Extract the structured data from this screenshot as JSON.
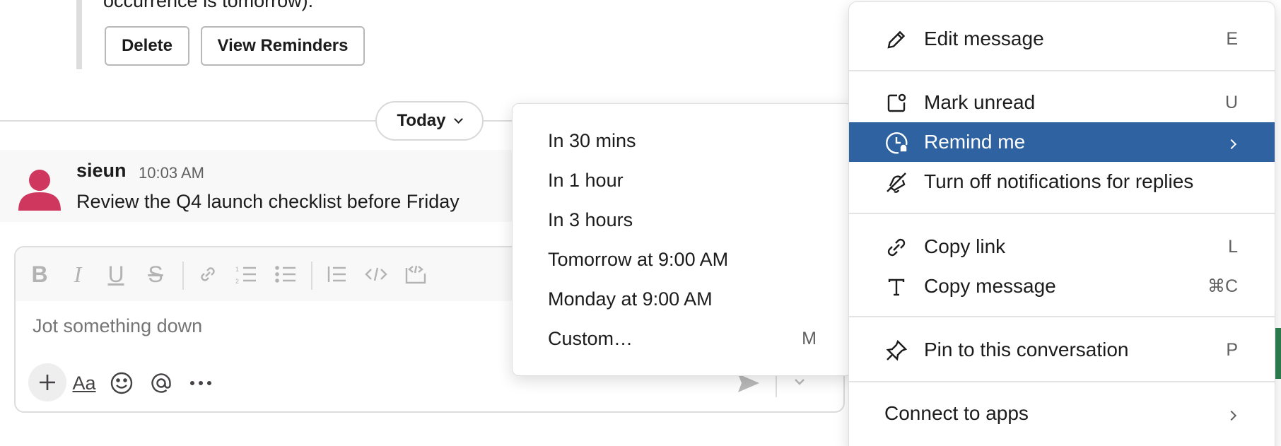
{
  "reminder": {
    "text": "occurrence is tomorrow).",
    "delete_label": "Delete",
    "view_label": "View Reminders"
  },
  "divider": {
    "label": "Today"
  },
  "message": {
    "author": "sieun",
    "time": "10:03 AM",
    "text": "Review the Q4 launch checklist before Friday",
    "avatar_color": "#d0375e"
  },
  "composer": {
    "placeholder": "Jot something down",
    "toolbar_icons": [
      "bold-icon",
      "italic-icon",
      "underline-icon",
      "strikethrough-icon",
      "link-icon",
      "ordered-list-icon",
      "bulleted-list-icon",
      "blockquote-icon",
      "code-icon",
      "code-block-icon"
    ],
    "bottom_icons": [
      "plus-icon",
      "format-text-icon",
      "emoji-icon",
      "mention-icon",
      "more-icon"
    ],
    "format_label": "Aa"
  },
  "remind_submenu": {
    "items": [
      {
        "label": "In 30 mins",
        "shortcut": ""
      },
      {
        "label": "In 1 hour",
        "shortcut": ""
      },
      {
        "label": "In 3 hours",
        "shortcut": ""
      },
      {
        "label": "Tomorrow at 9:00 AM",
        "shortcut": ""
      },
      {
        "label": "Monday at 9:00 AM",
        "shortcut": ""
      },
      {
        "label": "Custom…",
        "shortcut": "M"
      }
    ]
  },
  "context_menu": {
    "accent": "#2e62a1",
    "items": [
      {
        "label": "Edit message",
        "shortcut": "E",
        "icon": "pencil-icon"
      },
      {
        "label": "Mark unread",
        "shortcut": "U",
        "icon": "mark-unread-icon"
      },
      {
        "label": "Remind me",
        "shortcut": "",
        "icon": "clock-icon",
        "active": true
      },
      {
        "label": "Turn off notifications for replies",
        "shortcut": "",
        "icon": "bell-off-icon"
      },
      {
        "label": "Copy link",
        "shortcut": "L",
        "icon": "link-icon"
      },
      {
        "label": "Copy message",
        "shortcut": "⌘C",
        "icon": "text-icon"
      },
      {
        "label": "Pin to this conversation",
        "shortcut": "P",
        "icon": "pin-icon"
      },
      {
        "label": "Connect to apps",
        "shortcut": "",
        "icon": "chevron-right-icon"
      }
    ]
  }
}
